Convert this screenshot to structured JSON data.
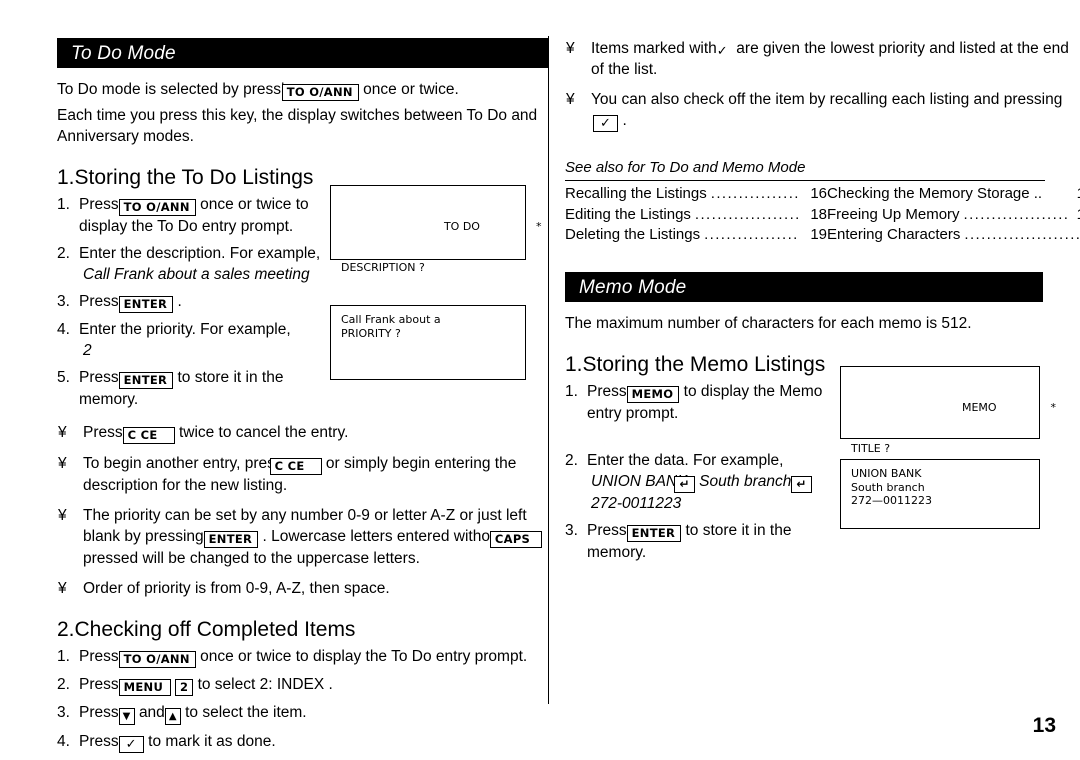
{
  "page": {
    "number": "13",
    "bullet_glyph": "¥"
  },
  "left_column": {
    "mode_header": "To Do Mode",
    "intro_1_pre": "To Do mode is selected by pressing",
    "intro_1_key": "TO  O/ANN",
    "intro_1_post": "once or twice.",
    "intro_2": "Each time you press this key, the display switches between To Do and Anniversary modes.",
    "section1": {
      "num": "1.",
      "title": "Storing the To Do Listings",
      "steps": [
        {
          "mk": "1.",
          "pre": "Press",
          "key": "TO  O/ANN",
          "post": "once or twice to display the To Do entry prompt."
        },
        {
          "mk": "2.",
          "pre": "Enter the description. For example,",
          "italic": "Call Frank about a sales meeting"
        },
        {
          "mk": "3.",
          "pre": "Press",
          "key": "ENTER",
          "post": "."
        },
        {
          "mk": "4.",
          "pre": "Enter the priority. For example,",
          "italic": "2"
        },
        {
          "mk": "5.",
          "pre": "Press",
          "key": "ENTER",
          "post": "to store it in the memory."
        }
      ],
      "lcd_1": {
        "line1": "TO DO",
        "line1_mark": "*",
        "line2": "DESCRIPTION ?"
      },
      "lcd_2": {
        "line1": "Call Frank about a",
        "line2": "PRIORITY ?"
      },
      "bullets": [
        {
          "pre": "Press",
          "key": "C CE",
          "post": "twice to cancel the entry."
        },
        {
          "pre": "To begin another entry, press",
          "key": "C CE",
          "post": "or simply begin entering the description for the new listing."
        },
        {
          "pre": "The priority can be set by any number 0-9 or letter A-Z or just left blank by pressing",
          "key": "ENTER",
          "mid": ". Lowercase letters entered without",
          "key2": "CAPS",
          "post": "pressed will be changed to the uppercase letters."
        },
        {
          "pre": "Order of priority is from 0-9, A-Z, then space."
        }
      ]
    },
    "section2": {
      "num": "2.",
      "title": "Checking off Completed Items",
      "steps": [
        {
          "mk": "1.",
          "pre": "Press",
          "key": "TO  O/ANN",
          "post": "once or twice to display the To Do entry prompt."
        },
        {
          "mk": "2.",
          "pre": "Press",
          "key": "MENU",
          "key2": "2",
          "post": "to select  2: INDEX ."
        },
        {
          "mk": "3.",
          "pre": "Press",
          "key": "▼",
          "mid": "and",
          "key2": "▲",
          "post": "to select the item."
        },
        {
          "mk": "4.",
          "pre": "Press",
          "key": "✓",
          "post": "to mark it as done."
        }
      ]
    }
  },
  "right_column": {
    "bullets": [
      {
        "pre": "Items marked with",
        "key": "✓",
        "post": "are given the lowest priority and listed at the end of the list."
      },
      {
        "pre": "You can also check off the item by recalling each listing and pressing",
        "key": "✓",
        "post": "."
      }
    ],
    "see_also": {
      "title": "See also for To Do and Memo Mode",
      "left": [
        {
          "label": "Recalling the Listings",
          "page": "16"
        },
        {
          "label": "Editing the Listings",
          "page": "18"
        },
        {
          "label": "Deleting the Listings",
          "page": "19"
        }
      ],
      "right": [
        {
          "label": "Checking the Memory Storage ..",
          "page": "1"
        },
        {
          "label": "Freeing Up Memory",
          "page": "1"
        },
        {
          "label": "Entering Characters",
          "page": ""
        }
      ]
    },
    "mode_header": "Memo Mode",
    "intro": "The maximum number of characters for each memo is 512.",
    "section1": {
      "num": "1.",
      "title": "Storing the Memo Listings",
      "steps": [
        {
          "mk": "1.",
          "pre": "Press",
          "key": "MEMO",
          "post": "to display the Memo entry prompt."
        },
        {
          "mk": "2.",
          "pre": "Enter the data. For example,",
          "italic_a": "UNION BANK",
          "key_a": "↵",
          "italic_b": "South branch",
          "key_b": "↵",
          "italic_c": "272-0011223"
        },
        {
          "mk": "3.",
          "pre": "Press",
          "key": "ENTER",
          "post": "to store it in the memory."
        }
      ],
      "lcd_1": {
        "line1": "MEMO",
        "line1_mark": "*",
        "line2": "TITLE ?"
      },
      "lcd_2": {
        "line1": "UNION BANK",
        "line2": "South branch",
        "line3": "272—0011223"
      }
    }
  }
}
